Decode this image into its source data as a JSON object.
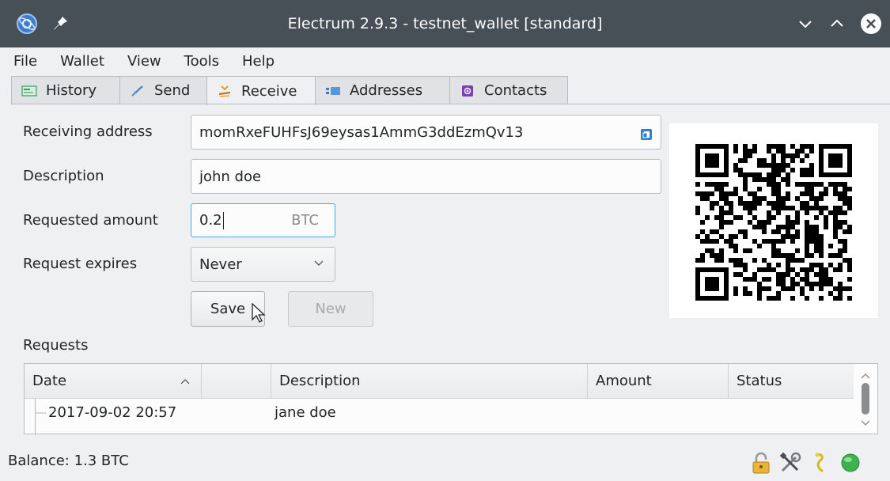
{
  "window": {
    "title": "Electrum 2.9.3 - testnet_wallet [standard]",
    "controls": [
      "minimize",
      "maximize",
      "close"
    ]
  },
  "menu": {
    "items": [
      {
        "label": "File"
      },
      {
        "label": "Wallet"
      },
      {
        "label": "View"
      },
      {
        "label": "Tools"
      },
      {
        "label": "Help"
      }
    ]
  },
  "tabs": [
    {
      "label": "History",
      "icon": "history-icon",
      "active": false
    },
    {
      "label": "Send",
      "icon": "send-icon",
      "active": false
    },
    {
      "label": "Receive",
      "icon": "receive-icon",
      "active": true
    },
    {
      "label": "Addresses",
      "icon": "addresses-icon",
      "active": false
    },
    {
      "label": "Contacts",
      "icon": "contacts-icon",
      "active": false
    }
  ],
  "receive": {
    "address_label": "Receiving address",
    "address_value": "momRxeFUHFsJ69eysas1AmmG3ddEzmQv13",
    "description_label": "Description",
    "description_value": "john doe",
    "amount_label": "Requested amount",
    "amount_value": "0.2",
    "amount_unit": "BTC",
    "expires_label": "Request expires",
    "expires_value": "Never",
    "save_label": "Save",
    "new_label": "New"
  },
  "requests": {
    "label": "Requests",
    "columns": [
      "Date",
      "",
      "Description",
      "Amount",
      "Status"
    ],
    "rows": [
      {
        "date": "2017-09-02 20:57",
        "description": "jane doe",
        "amount": "",
        "status": ""
      }
    ]
  },
  "status": {
    "balance": "Balance: 1.3 BTC",
    "icons": [
      "lock-icon",
      "preferences-icon",
      "seed-icon",
      "network-status-icon"
    ],
    "network_color": "#3fb24f"
  },
  "colors": {
    "titlebar": "#475057",
    "window_bg": "#eff0f1",
    "focus": "#3daee9"
  }
}
